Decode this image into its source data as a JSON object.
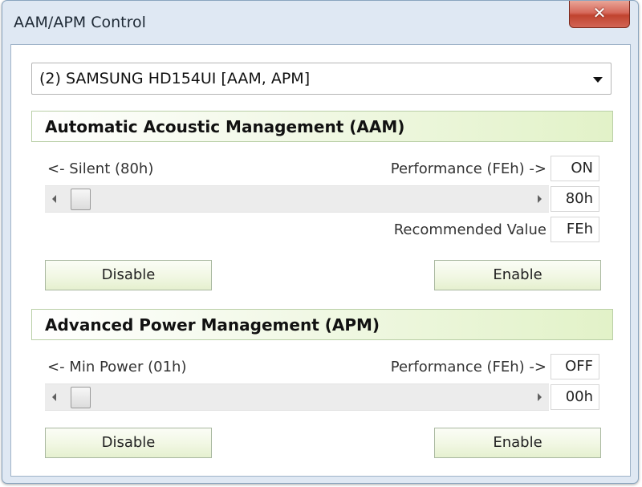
{
  "window": {
    "title": "AAM/APM Control",
    "close_glyph": "✕"
  },
  "drive_select": {
    "value": "(2) SAMSUNG HD154UI [AAM, APM]"
  },
  "aam": {
    "header": "Automatic Acoustic Management (AAM)",
    "min_label": "<- Silent (80h)",
    "max_label": "Performance (FEh) ->",
    "status": "ON",
    "current_value": "80h",
    "slider_level": 0,
    "recommended_label": "Recommended Value",
    "recommended_value": "FEh",
    "disable_label": "Disable",
    "enable_label": "Enable"
  },
  "apm": {
    "header": "Advanced Power Management (APM)",
    "min_label": "<- Min Power (01h)",
    "max_label": "Performance (FEh) ->",
    "status": "OFF",
    "current_value": "00h",
    "slider_level": 0,
    "disable_label": "Disable",
    "enable_label": "Enable"
  },
  "colors": {
    "close_button": "#c8503f",
    "section_header_gradient_end": "#e2f2c8",
    "button_gradient_end": "#e5f0cf"
  }
}
